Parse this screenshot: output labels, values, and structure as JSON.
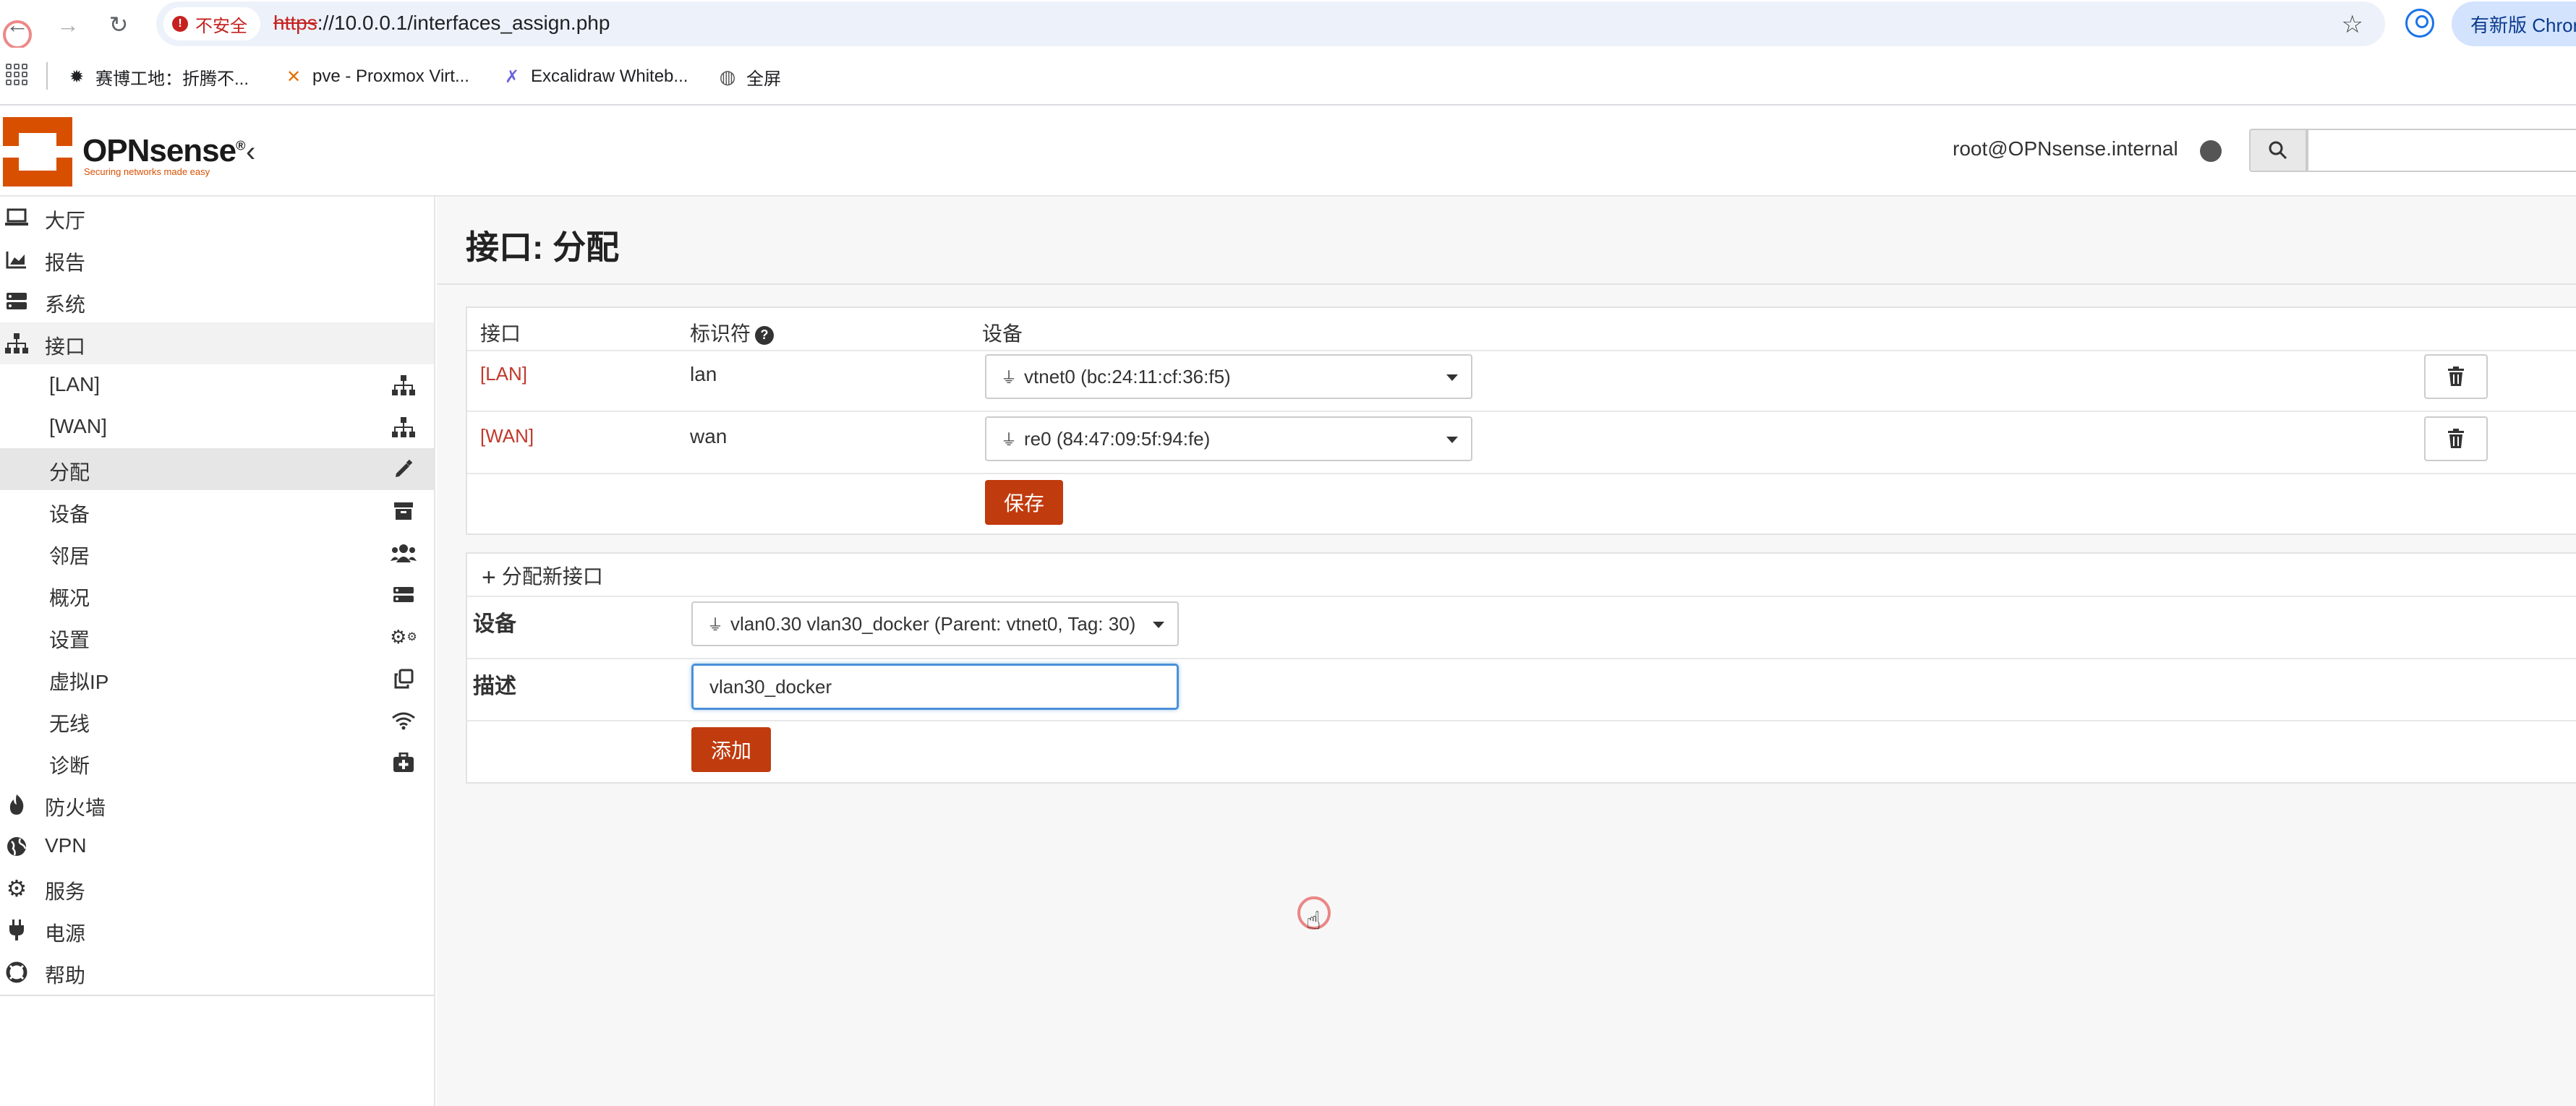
{
  "browser": {
    "insecure_label": "不安全",
    "url_protocol": "https",
    "url_rest": "://10.0.0.1/interfaces_assign.php",
    "update_button": "有新版 Chrome",
    "bookmarks": [
      {
        "label": "赛博工地：折腾不...",
        "icon": "gear"
      },
      {
        "label": "pve - Proxmox Virt...",
        "icon": "proxmox"
      },
      {
        "label": "Excalidraw Whiteb...",
        "icon": "excalidraw"
      },
      {
        "label": "全屏",
        "icon": "globe"
      }
    ]
  },
  "header": {
    "logo_text": "OPNsense",
    "logo_registered": "®",
    "logo_tagline": "Securing networks made easy",
    "user": "root@OPNsense.internal"
  },
  "sidebar": {
    "items": [
      {
        "label": "大厅",
        "icon": "laptop-icon"
      },
      {
        "label": "报告",
        "icon": "chart-icon"
      },
      {
        "label": "系统",
        "icon": "server-icon"
      },
      {
        "label": "接口",
        "icon": "sitemap-icon"
      },
      {
        "label": "[LAN]",
        "icon": "sitemap-icon"
      },
      {
        "label": "[WAN]",
        "icon": "sitemap-icon"
      },
      {
        "label": "分配",
        "icon": "pencil-icon"
      },
      {
        "label": "设备",
        "icon": "archive-icon"
      },
      {
        "label": "邻居",
        "icon": "users-icon"
      },
      {
        "label": "概况",
        "icon": "server-icon"
      },
      {
        "label": "设置",
        "icon": "cogs-icon"
      },
      {
        "label": "虚拟IP",
        "icon": "clone-icon"
      },
      {
        "label": "无线",
        "icon": "wifi-icon"
      },
      {
        "label": "诊断",
        "icon": "medkit-icon"
      },
      {
        "label": "防火墙",
        "icon": "fire-icon"
      },
      {
        "label": "VPN",
        "icon": "globe-icon"
      },
      {
        "label": "服务",
        "icon": "cog-icon"
      },
      {
        "label": "电源",
        "icon": "plug-icon"
      },
      {
        "label": "帮助",
        "icon": "lifebuoy-icon"
      }
    ]
  },
  "page": {
    "title": "接口: 分配",
    "table": {
      "headers": {
        "interface": "接口",
        "identifier": "标识符",
        "device": "设备"
      },
      "rows": [
        {
          "interface": "[LAN]",
          "identifier": "lan",
          "device": "vtnet0 (bc:24:11:cf:36:f5)"
        },
        {
          "interface": "[WAN]",
          "identifier": "wan",
          "device": "re0 (84:47:09:5f:94:fe)"
        }
      ],
      "save_label": "保存"
    },
    "assign_new": {
      "header": "分配新接口",
      "device_label": "设备",
      "device_value": "vlan0.30 vlan30_docker (Parent: vtnet0, Tag: 30)",
      "description_label": "描述",
      "description_value": "vlan30_docker",
      "add_label": "添加"
    }
  },
  "colors": {
    "accent": "#c03b0e",
    "link": "#c0392b",
    "logo": "#d94f00"
  }
}
